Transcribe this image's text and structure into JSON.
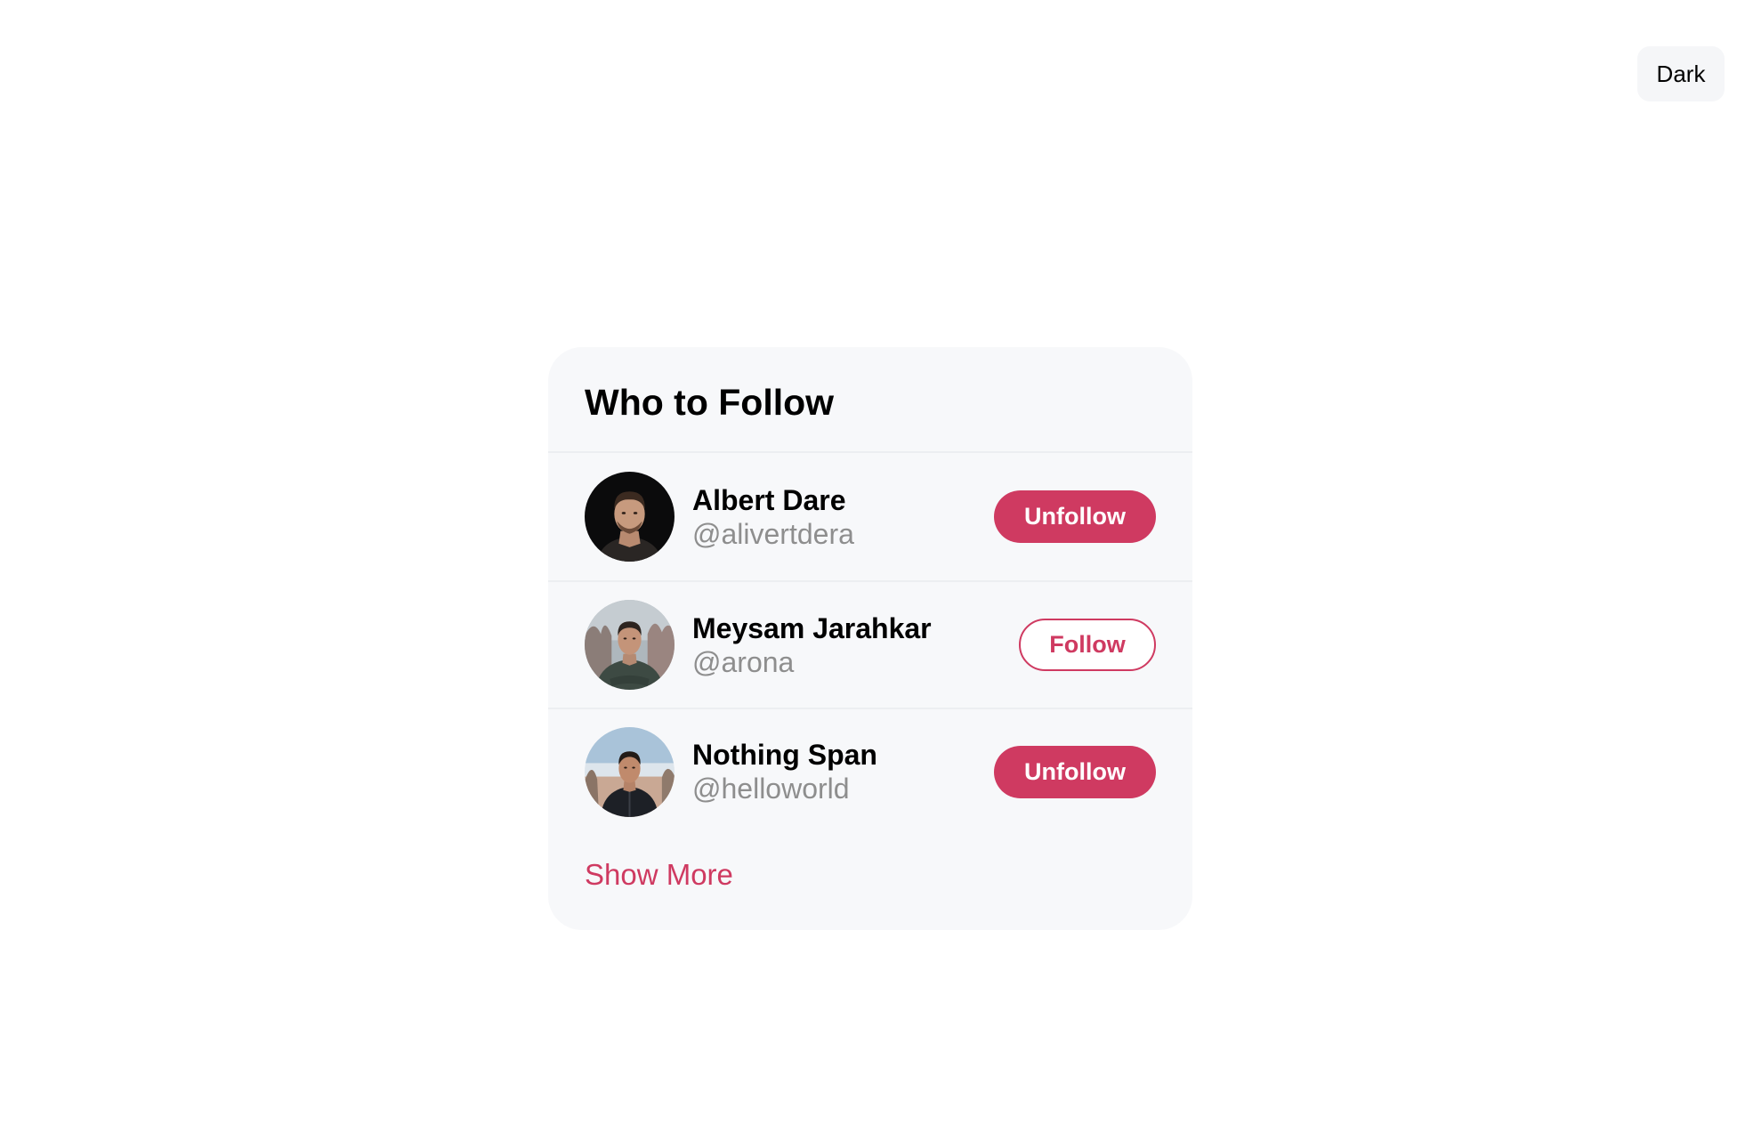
{
  "theme_toggle": {
    "label": "Dark"
  },
  "widget": {
    "title": "Who to Follow",
    "show_more_label": "Show More",
    "users": [
      {
        "name": "Albert Dare",
        "handle": "@alivertdera",
        "action_label": "Unfollow",
        "following": true,
        "avatar": "portrait-man-dark-background"
      },
      {
        "name": "Meysam Jarahkar",
        "handle": "@arona",
        "action_label": "Follow",
        "following": false,
        "avatar": "portrait-man-outdoor-trees"
      },
      {
        "name": "Nothing Span",
        "handle": "@helloworld",
        "action_label": "Unfollow",
        "following": true,
        "avatar": "portrait-man-outdoor-sky"
      }
    ]
  },
  "colors": {
    "accent": "#cf3a61",
    "card_background": "#f7f8fa",
    "handle_text": "#8e8e8e",
    "page_background": "#ffffff"
  }
}
